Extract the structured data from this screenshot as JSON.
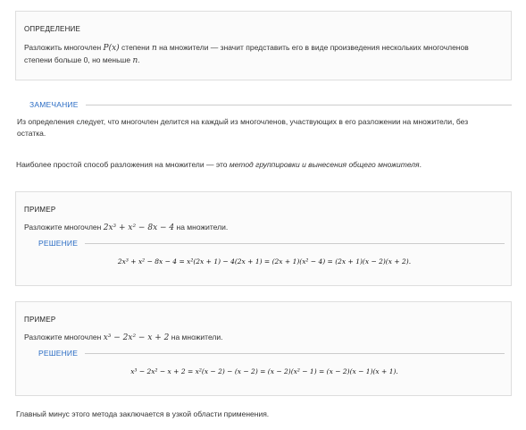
{
  "definition": {
    "label": "ОПРЕДЕЛЕНИЕ",
    "text_1": "Разложить многочлен ",
    "poly": "P(x)",
    "text_2": " степени ",
    "n1": "n",
    "text_3": " на множители — значит представить его в виде произведения нескольких многочленов",
    "text_4": "степени больше 0, но меньше ",
    "n2": "n",
    "text_5": "."
  },
  "remark": {
    "label": "ЗАМЕЧАНИЕ",
    "text_line1": "Из определения следует, что многочлен делится на каждый из многочленов, участвующих в его разложении на множители, без",
    "text_line2": "остатка."
  },
  "intro": {
    "text_1": "Наиболее простой способ разложения на множители — это ",
    "method": "метод группировки и вынесения общего множителя",
    "text_2": "."
  },
  "example1": {
    "label": "ПРИМЕР",
    "task_1": "Разложите многочлен ",
    "poly": "2x³ + x² − 8x − 4",
    "task_2": " на множители.",
    "solution_label": "РЕШЕНИЕ",
    "formula": "2x³ + x² − 8x − 4 = x²(2x + 1) − 4(2x + 1) = (2x + 1)(x² − 4) = (2x + 1)(x − 2)(x + 2)."
  },
  "example2": {
    "label": "ПРИМЕР",
    "task_1": "Разложите многочлен ",
    "poly": "x³ − 2x² − x + 2",
    "task_2": " на множители.",
    "solution_label": "РЕШЕНИЕ",
    "formula": "x³ − 2x² − x + 2 = x²(x − 2) − (x − 2) = (x − 2)(x² − 1) = (x − 2)(x − 1)(x + 1)."
  },
  "footer": {
    "text": "Главный минус этого метода заключается в узкой области применения."
  },
  "colors": {
    "accent": "#2a6cc4",
    "border": "#dedede",
    "box_bg": "#fbfbfb",
    "rule": "#cccccc"
  }
}
